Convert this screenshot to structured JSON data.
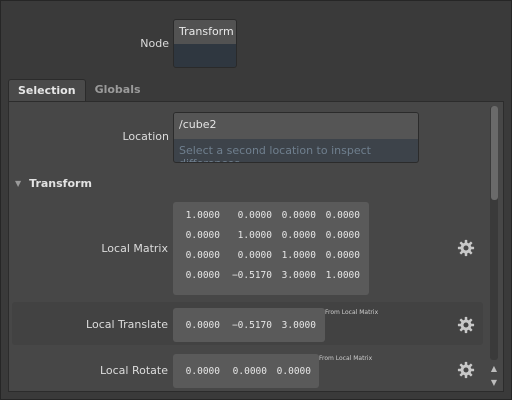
{
  "node": {
    "label": "Node",
    "value": "Transform"
  },
  "tabs": [
    {
      "label": "Selection",
      "active": true
    },
    {
      "label": "Globals",
      "active": false
    }
  ],
  "location": {
    "label": "Location",
    "value": "/cube2",
    "placeholder": "Select a second location to inspect differences"
  },
  "section": {
    "title": "Transform",
    "expanded": true
  },
  "local_matrix": {
    "label": "Local Matrix",
    "rows": [
      [
        "1.0000",
        "0.0000",
        "0.0000",
        "0.0000"
      ],
      [
        "0.0000",
        "1.0000",
        "0.0000",
        "0.0000"
      ],
      [
        "0.0000",
        "0.0000",
        "1.0000",
        "0.0000"
      ],
      [
        "0.0000",
        "−0.5170",
        "3.0000",
        "1.0000"
      ]
    ]
  },
  "local_translate": {
    "label": "Local Translate",
    "values": [
      "0.0000",
      "−0.5170",
      "3.0000"
    ],
    "note": "From Local Matrix"
  },
  "local_rotate": {
    "label": "Local Rotate",
    "values": [
      "0.0000",
      "0.0000",
      "0.0000"
    ],
    "note": "From Local Matrix"
  },
  "icons": {
    "settings": "gear-icon",
    "collapse": "triangle-down-icon",
    "scroll_up": "arrow-up-icon",
    "scroll_down": "arrow-down-icon"
  },
  "colors": {
    "background": "#3a3a3a",
    "panel": "#474747",
    "field": "#5a5a5a",
    "placeholder": "#6f7f8e"
  }
}
